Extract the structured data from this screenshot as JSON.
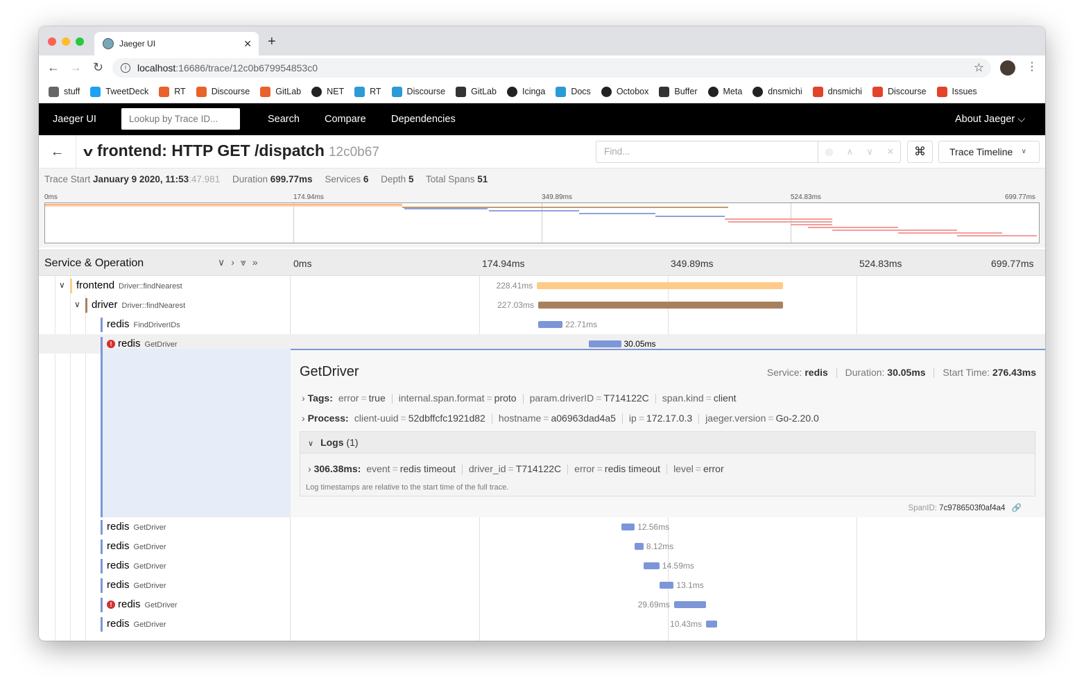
{
  "browser": {
    "tab_title": "Jaeger UI",
    "url_host": "localhost",
    "url_rest": ":16686/trace/12c0b679954853c0"
  },
  "bookmarks": [
    {
      "label": "stuff",
      "icon": "folder-icon",
      "color": "#666666"
    },
    {
      "label": "TweetDeck",
      "icon": "tweetdeck-icon",
      "color": "#1da1f2"
    },
    {
      "label": "RT",
      "icon": "rt-icon",
      "color": "#e8622c"
    },
    {
      "label": "Discourse",
      "icon": "rt-icon",
      "color": "#e8622c"
    },
    {
      "label": "GitLab",
      "icon": "rt-icon",
      "color": "#e8622c"
    },
    {
      "label": "NET",
      "icon": "github-icon",
      "color": "#222222"
    },
    {
      "label": "RT",
      "icon": "box-icon",
      "color": "#2c9ad6"
    },
    {
      "label": "Discourse",
      "icon": "box-icon",
      "color": "#2c9ad6"
    },
    {
      "label": "GitLab",
      "icon": "dots-icon",
      "color": "#333333"
    },
    {
      "label": "Icinga",
      "icon": "github-icon",
      "color": "#222222"
    },
    {
      "label": "Docs",
      "icon": "box-icon",
      "color": "#2c9ad6"
    },
    {
      "label": "Octobox",
      "icon": "octobox-icon",
      "color": "#222222"
    },
    {
      "label": "Buffer",
      "icon": "buffer-icon",
      "color": "#333333"
    },
    {
      "label": "Meta",
      "icon": "chat-icon",
      "color": "#222222"
    },
    {
      "label": "dnsmichi",
      "icon": "github-icon",
      "color": "#222222"
    },
    {
      "label": "dnsmichi",
      "icon": "gitlab-icon",
      "color": "#e24329"
    },
    {
      "label": "Discourse",
      "icon": "gitlab-icon",
      "color": "#e24329"
    },
    {
      "label": "Issues",
      "icon": "gitlab-icon",
      "color": "#e24329"
    }
  ],
  "nav": {
    "brand": "Jaeger UI",
    "lookup_placeholder": "Lookup by Trace ID...",
    "search": "Search",
    "compare": "Compare",
    "dependencies": "Dependencies",
    "about": "About Jaeger ⌵"
  },
  "header": {
    "title": "frontend: HTTP GET /dispatch",
    "trace_id": "12c0b67",
    "find_placeholder": "Find...",
    "view_button": "Trace Timeline"
  },
  "meta": {
    "start_label": "Trace Start",
    "start_value": "January 9 2020, 11:53",
    "start_ms": ":47.981",
    "duration_label": "Duration",
    "duration": "699.77ms",
    "services_label": "Services",
    "services": "6",
    "depth_label": "Depth",
    "depth": "5",
    "spans_label": "Total Spans",
    "spans": "51"
  },
  "ticks": [
    "0ms",
    "174.94ms",
    "349.89ms",
    "524.83ms",
    "699.77ms"
  ],
  "span_header": {
    "label": "Service & Operation"
  },
  "spans": [
    {
      "service": "frontend",
      "op": "Driver::findNearest",
      "color": "#ffcb8a",
      "barColor": "#ffcb8a",
      "start": 228.5,
      "dur": 228.41,
      "label": "228.41ms",
      "labelSide": "left",
      "depth": 1,
      "caret": true,
      "error": false
    },
    {
      "service": "driver",
      "op": "Driver::findNearest",
      "color": "#a9805d",
      "barColor": "#a9805d",
      "start": 229.5,
      "dur": 227.03,
      "label": "227.03ms",
      "labelSide": "left",
      "depth": 2,
      "caret": true,
      "error": false
    },
    {
      "service": "redis",
      "op": "FindDriverIDs",
      "color": "#7d96d8",
      "barColor": "#7d96d8",
      "start": 229.5,
      "dur": 22.71,
      "label": "22.71ms",
      "labelSide": "right",
      "depth": 3,
      "caret": false,
      "error": false
    },
    {
      "service": "redis",
      "op": "GetDriver",
      "color": "#7d96d8",
      "barColor": "#7d96d8",
      "start": 276.43,
      "dur": 30.05,
      "label": "30.05ms",
      "labelSide": "right",
      "depth": 3,
      "caret": false,
      "error": true
    }
  ],
  "spans_after": [
    {
      "service": "redis",
      "op": "GetDriver",
      "start": 306.5,
      "dur": 12.56,
      "label": "12.56ms",
      "labelSide": "right",
      "error": false
    },
    {
      "service": "redis",
      "op": "GetDriver",
      "start": 319.2,
      "dur": 8.12,
      "label": "8.12ms",
      "labelSide": "right",
      "error": false
    },
    {
      "service": "redis",
      "op": "GetDriver",
      "start": 327.5,
      "dur": 14.59,
      "label": "14.59ms",
      "labelSide": "right",
      "error": false
    },
    {
      "service": "redis",
      "op": "GetDriver",
      "start": 342.2,
      "dur": 13.1,
      "label": "13.1ms",
      "labelSide": "right",
      "error": false
    },
    {
      "service": "redis",
      "op": "GetDriver",
      "start": 355.5,
      "dur": 29.69,
      "label": "29.69ms",
      "labelSide": "left",
      "error": true
    },
    {
      "service": "redis",
      "op": "GetDriver",
      "start": 385.3,
      "dur": 10.43,
      "label": "10.43ms",
      "labelSide": "left",
      "error": false
    }
  ],
  "detail": {
    "op": "GetDriver",
    "service_label": "Service:",
    "service": "redis",
    "duration_label": "Duration:",
    "duration": "30.05ms",
    "start_label": "Start Time:",
    "start": "276.43ms",
    "tags_label": "Tags:",
    "tags": [
      {
        "k": "error",
        "v": "true"
      },
      {
        "k": "internal.span.format",
        "v": "proto"
      },
      {
        "k": "param.driverID",
        "v": "T714122C"
      },
      {
        "k": "span.kind",
        "v": "client"
      }
    ],
    "process_label": "Process:",
    "process": [
      {
        "k": "client-uuid",
        "v": "52dbffcfc1921d82"
      },
      {
        "k": "hostname",
        "v": "a06963dad4a5"
      },
      {
        "k": "ip",
        "v": "172.17.0.3"
      },
      {
        "k": "jaeger.version",
        "v": "Go-2.20.0"
      }
    ],
    "logs_label": "Logs",
    "logs_count": "(1)",
    "log_time": "306.38ms:",
    "log_fields": [
      {
        "k": "event",
        "v": "redis timeout"
      },
      {
        "k": "driver_id",
        "v": "T714122C"
      },
      {
        "k": "error",
        "v": "redis timeout"
      },
      {
        "k": "level",
        "v": "error"
      }
    ],
    "log_note": "Log timestamps are relative to the start time of the full trace.",
    "spanid_label": "SpanID:",
    "spanid": "7c9786503f0af4a4"
  }
}
